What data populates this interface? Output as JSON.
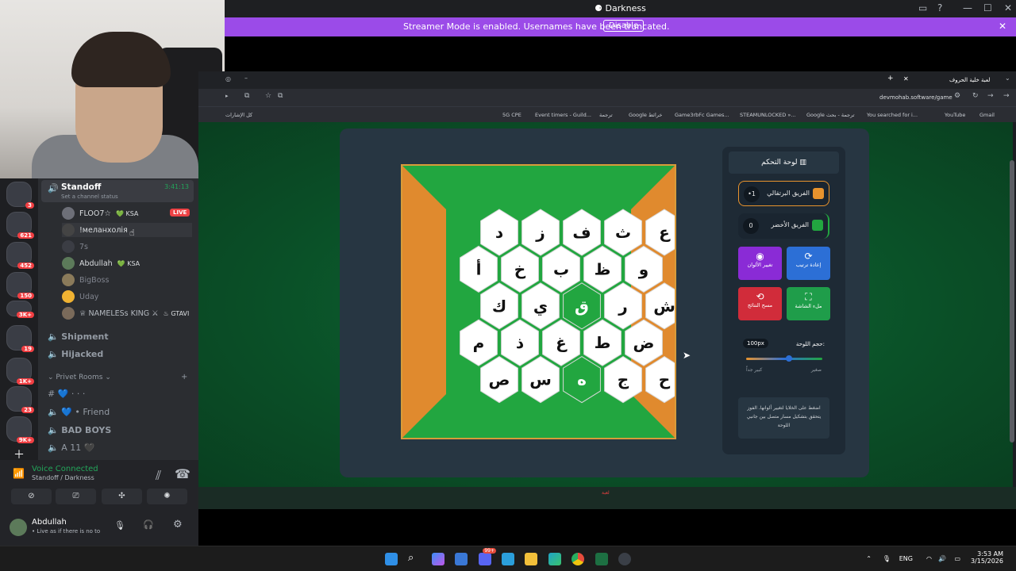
{
  "window": {
    "title": "Darkness",
    "title_icon": "discord-icon"
  },
  "streamer_banner": {
    "message": "Streamer Mode is enabled. Usernames have been truncated.",
    "button": "Disable"
  },
  "server_badges": [
    "3",
    "621",
    "452",
    "150",
    "3K+",
    "19",
    "1K+",
    "23",
    "9K+"
  ],
  "channels": {
    "active_voice": {
      "name": "Standoff",
      "timer": "3:41:13",
      "status": "Set a channel status"
    },
    "users": [
      {
        "name": "FLOO7☆",
        "tag": "💚 KSA",
        "live": "LIVE"
      },
      {
        "name": "!мeланхолія",
        "tag": ""
      },
      {
        "name": "7s",
        "tag": ""
      },
      {
        "name": "Abdullah",
        "tag": "💚 KSA"
      },
      {
        "name": "BigBoss",
        "tag": ""
      },
      {
        "name": "Uday",
        "tag": ""
      },
      {
        "name": "♕ NAMELESs KING ⚔",
        "tag": "♨ GTAVI"
      }
    ],
    "voice_channels": [
      "Shipment",
      "Hijacked"
    ],
    "category": "Privet Rooms",
    "room_channels": [
      "💙 · · ·",
      "💙 • Friend",
      "BAD BOYS",
      "A 11 🖤"
    ]
  },
  "voice_panel": {
    "status": "Voice Connected",
    "location": "Standoff / Darkness"
  },
  "user_panel": {
    "name": "Abdullah",
    "status": "• Live as if there is no to"
  },
  "browser": {
    "tab_title": "لعبة خلية الحروف",
    "url": "devmohab.software/game",
    "bookmarks_left": "كل الإشارات",
    "bookmarks": [
      "5G CPE",
      "Event timers - Guild...",
      "ترجمة",
      "Google خرائط",
      "Game3rbFc Games...",
      "STEAMUNLOCKED »...",
      "Google ترجمة - بحث",
      "You searched for i...",
      "YouTube",
      "Gmail"
    ],
    "footer_logo": "لعبة"
  },
  "board": {
    "letters": [
      [
        "د",
        "ز",
        "ف",
        "ث",
        "ع"
      ],
      [
        "أ",
        "خ",
        "ب",
        "ظ",
        "و"
      ],
      [
        "ك",
        "ي",
        "ق",
        "ر",
        "ش"
      ],
      [
        "م",
        "ذ",
        "غ",
        "ط",
        "ض"
      ],
      [
        "ص",
        "س",
        "ه",
        "ج",
        "ح"
      ]
    ],
    "green_cells": [
      "ق",
      "ه"
    ],
    "colors": {
      "green": "#22a640",
      "orange": "#e08a2e",
      "hex": "#ffffff",
      "frame": "#d89b3a"
    }
  },
  "control_panel": {
    "title": "لوحة التحكم",
    "teams": [
      {
        "name": "الفريق البرتقالي",
        "score": "•1",
        "color": "#e8932d"
      },
      {
        "name": "الفريق الأخضر",
        "score": "0",
        "color": "#22a640"
      }
    ],
    "buttons": [
      {
        "label": "تغيير الألوان",
        "icon": "palette-icon",
        "color": "#8a2bd6"
      },
      {
        "label": "إعادة ترتيب",
        "icon": "refresh-icon",
        "color": "#2c6fd6"
      },
      {
        "label": "مسح النتائج",
        "icon": "reset-icon",
        "color": "#d12c3a"
      },
      {
        "label": "ملء الشاشة",
        "icon": "fullscreen-icon",
        "color": "#1f9d4a"
      }
    ],
    "size": {
      "label": "حجم اللوحة:",
      "value": "100px",
      "min_label": "كبير جداً",
      "max_label": "صغير",
      "level": 0.56
    },
    "note": "اضغط على الخلايا لتغيير ألوانها. الفوز يتحقق بتشكيل مسار متصل بين جانبي اللوحة"
  },
  "taskbar": {
    "apps": [
      "windows-icon",
      "search-icon",
      "copilot-icon",
      "store-icon",
      "discord-icon",
      "notepad-icon",
      "explorer-icon",
      "edge-icon",
      "chrome-icon",
      "excel-icon",
      "steam-icon"
    ],
    "discord_badge": "99+",
    "lang": "ENG",
    "time": "3:53 AM",
    "date": "3/15/2026"
  }
}
